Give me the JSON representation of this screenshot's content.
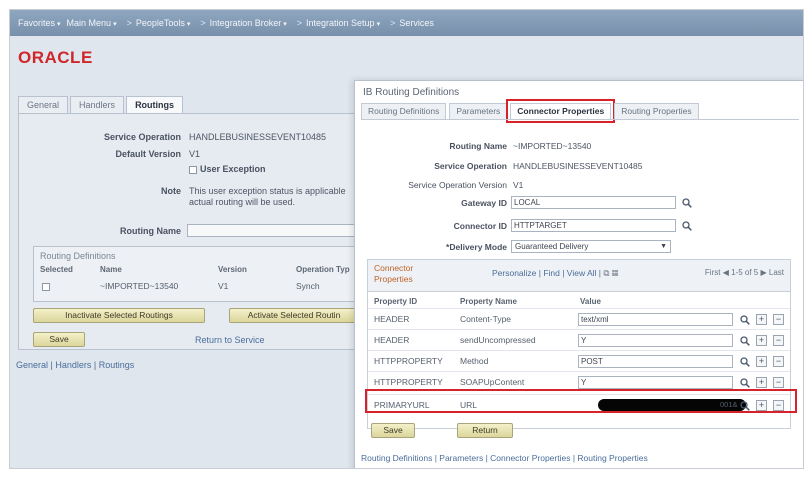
{
  "nav": {
    "items": [
      "Favorites",
      "Main Menu",
      "PeopleTools",
      "Integration Broker",
      "Integration Setup",
      "Services"
    ],
    "separator": ">"
  },
  "logo": "ORACLE",
  "left": {
    "tabs": [
      "General",
      "Handlers",
      "Routings"
    ],
    "active_tab": "Routings",
    "service_operation_label": "Service Operation",
    "service_operation_value": "HANDLEBUSINESSEVENT10485",
    "default_version_label": "Default Version",
    "default_version_value": "V1",
    "user_exception_label": "User Exception",
    "note_label": "Note",
    "note_text": "This user exception status is applicable actual routing will be used.",
    "routing_name_label": "Routing Name",
    "routing_name_value": "",
    "grid": {
      "title": "Routing Definitions",
      "headers": [
        "Selected",
        "Name",
        "Version",
        "Operation Typ"
      ],
      "row": {
        "name": "~IMPORTED~13540",
        "version": "V1",
        "operation_type": "Synch"
      }
    },
    "inactivate_button": "Inactivate Selected Routings",
    "activate_button": "Activate Selected Routin",
    "save_button": "Save",
    "return_link": "Return to Service",
    "bottom_links": "General | Handlers | Routings"
  },
  "modal": {
    "title": "IB Routing Definitions",
    "tabs": [
      "Routing Definitions",
      "Parameters",
      "Connector Properties",
      "Routing Properties"
    ],
    "active_tab": "Connector Properties",
    "routing_name_label": "Routing Name",
    "routing_name_value": "~IMPORTED~13540",
    "service_operation_label": "Service Operation",
    "service_operation_value": "HANDLEBUSINESSEVENT10485",
    "sov_label": "Service Operation Version",
    "sov_value": "V1",
    "gateway_label": "Gateway ID",
    "gateway_value": "LOCAL",
    "connector_label": "Connector ID",
    "connector_value": "HTTPTARGET",
    "delivery_label": "*Delivery Mode",
    "delivery_value": "Guaranteed Delivery",
    "grid": {
      "title": "Connector Properties",
      "tools": "Personalize | Find | View All |",
      "nav_first": "First",
      "nav_count": "1-5 of 5",
      "nav_last": "Last",
      "headers": [
        "Property ID",
        "Property Name",
        "Value"
      ],
      "rows": [
        {
          "id": "HEADER",
          "name": "Content-Type",
          "value": "text/xml"
        },
        {
          "id": "HEADER",
          "name": "sendUncompressed",
          "value": "Y"
        },
        {
          "id": "HTTPPROPERTY",
          "name": "Method",
          "value": "POST"
        },
        {
          "id": "HTTPPROPERTY",
          "name": "SOAPUpContent",
          "value": "Y"
        },
        {
          "id": "PRIMARYURL",
          "name": "URL",
          "value_suffix": "001&"
        }
      ]
    },
    "save_button": "Save",
    "return_button": "Return",
    "links": "Routing Definitions | Parameters | Connector Properties | Routing Properties"
  },
  "colors": {
    "highlight": "#d8222a",
    "oracle_red": "#d0262a",
    "link": "#4a6d9a",
    "nav_bg": "#8198b3"
  }
}
